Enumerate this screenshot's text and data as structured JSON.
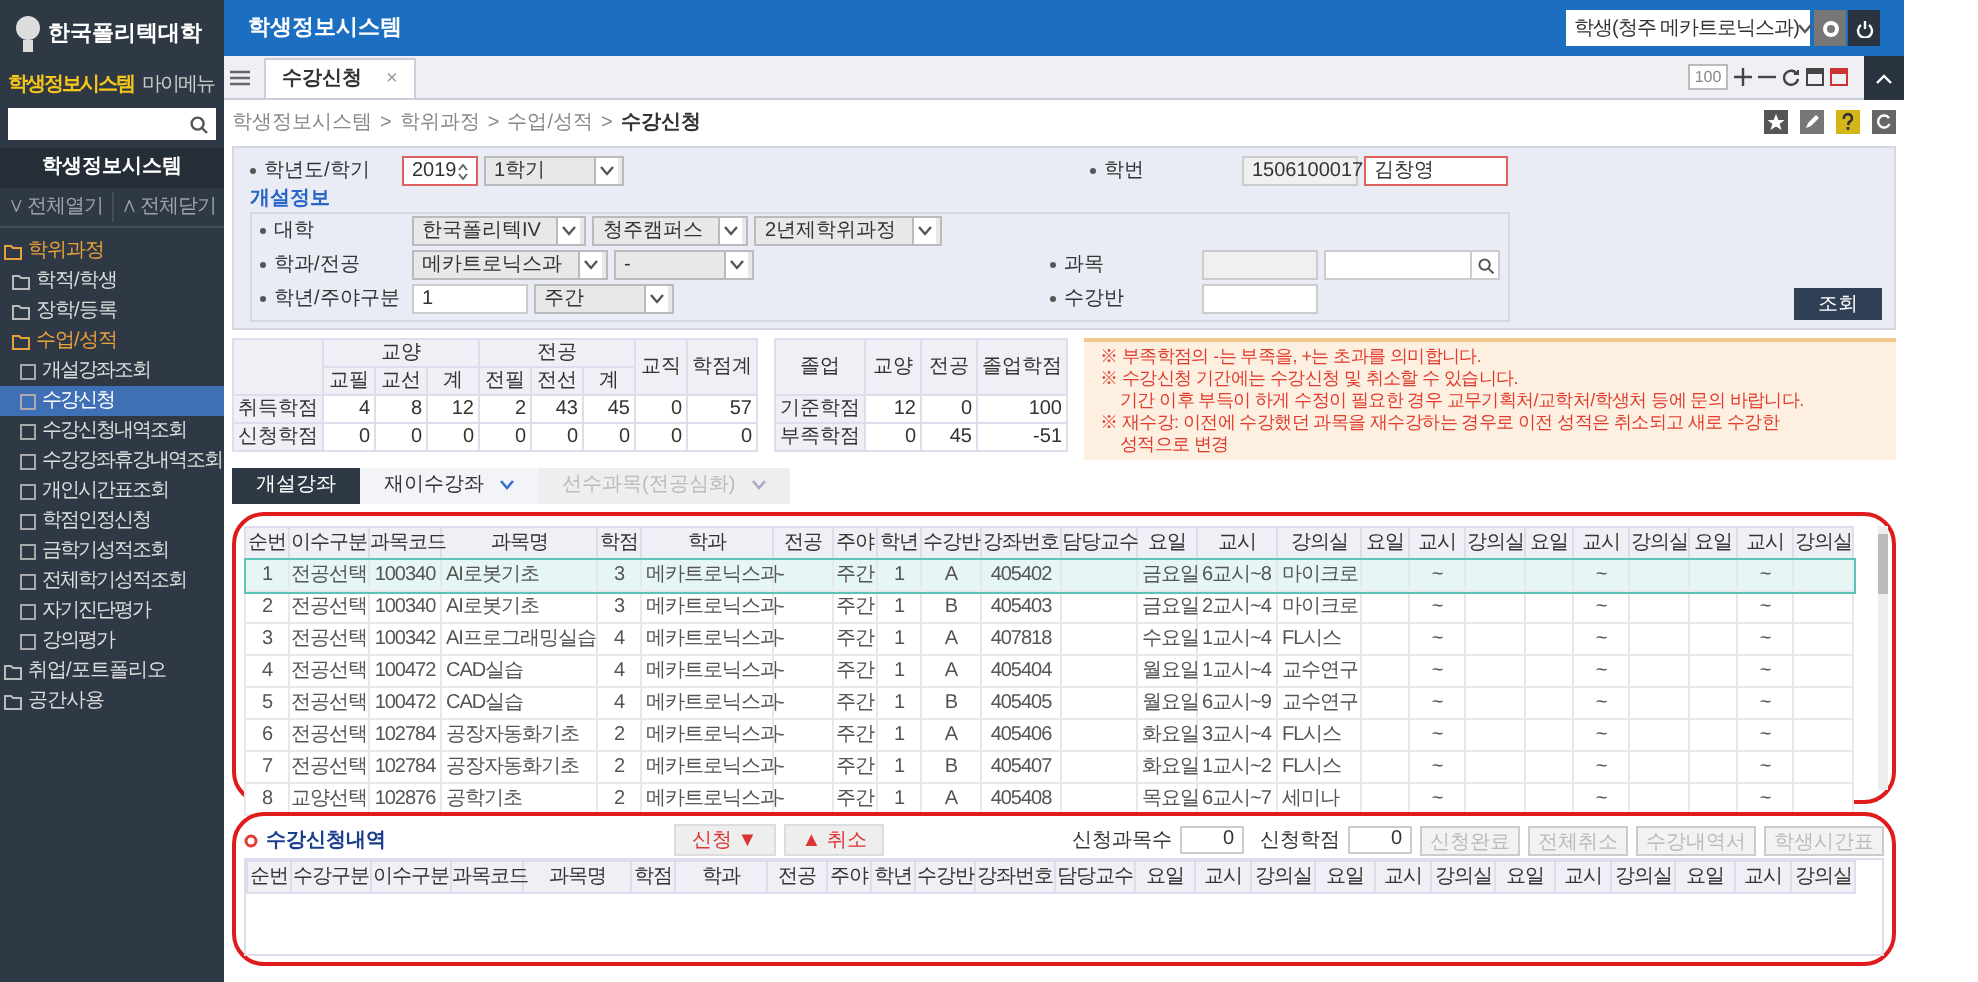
{
  "sidebar": {
    "logo": "한국폴리텍대학",
    "tabs": [
      {
        "label": "학생정보시스템",
        "selected": true
      },
      {
        "label": "마이메뉴",
        "selected": false
      }
    ],
    "section_title": "학생정보시스템",
    "expand_all": "∨ 전체열기",
    "collapse_all": "∧ 전체닫기",
    "tree": [
      {
        "kind": "folder",
        "label": "학위과정",
        "expanded": true,
        "children": [
          {
            "kind": "folder",
            "label": "학적/학생",
            "expanded": false
          },
          {
            "kind": "folder",
            "label": "장학/등록",
            "expanded": false
          },
          {
            "kind": "folder",
            "label": "수업/성적",
            "expanded": true,
            "children": [
              {
                "kind": "page",
                "label": "개설강좌조회",
                "selected": false
              },
              {
                "kind": "page",
                "label": "수강신청",
                "selected": true
              },
              {
                "kind": "page",
                "label": "수강신청내역조회",
                "selected": false
              },
              {
                "kind": "page",
                "label": "수강강좌휴강내역조회",
                "selected": false
              },
              {
                "kind": "page",
                "label": "개인시간표조회",
                "selected": false
              },
              {
                "kind": "page",
                "label": "학점인정신청",
                "selected": false
              },
              {
                "kind": "page",
                "label": "금학기성적조회",
                "selected": false
              },
              {
                "kind": "page",
                "label": "전체학기성적조회",
                "selected": false
              },
              {
                "kind": "page",
                "label": "자기진단평가",
                "selected": false
              },
              {
                "kind": "page",
                "label": "강의평가",
                "selected": false
              }
            ]
          }
        ]
      },
      {
        "kind": "folder",
        "label": "취업/포트폴리오",
        "expanded": false
      },
      {
        "kind": "folder",
        "label": "공간사용",
        "expanded": false
      }
    ]
  },
  "top_bar": {
    "title": "학생정보시스템",
    "user_select": "학생(청주 메카트로닉스과)"
  },
  "tab_bar": {
    "tabs": [
      {
        "label": "수강신청",
        "selected": true,
        "close": "×"
      }
    ],
    "zoom": "100"
  },
  "breadcrumb": {
    "separator": ">",
    "items": [
      "학생정보시스템",
      "학위과정",
      "수업/성적",
      "수강신청"
    ]
  },
  "form": {
    "top_left": {
      "label": "학년도/학기",
      "controls": [
        {
          "kind": "spinner",
          "value": "2019"
        },
        {
          "kind": "select",
          "value": "1학기"
        }
      ]
    },
    "top_right": {
      "label": "학번",
      "controls": [
        {
          "kind": "text",
          "value": "1506100017",
          "readonly": true
        },
        {
          "kind": "text",
          "value": "김창영",
          "highlighted": true
        }
      ]
    },
    "group": {
      "title": "개설정보",
      "left": [
        {
          "label": "대학",
          "controls": [
            {
              "kind": "select",
              "value": "한국폴리텍IV"
            },
            {
              "kind": "select",
              "value": "청주캠퍼스"
            },
            {
              "kind": "select",
              "value": "2년제학위과정"
            }
          ]
        },
        {
          "label": "학과/전공",
          "controls": [
            {
              "kind": "select",
              "value": "메카트로닉스과"
            },
            {
              "kind": "select",
              "value": "-"
            }
          ]
        },
        {
          "label": "학년/주야구분",
          "controls": [
            {
              "kind": "text",
              "value": "1"
            },
            {
              "kind": "select",
              "value": "주간"
            }
          ]
        }
      ],
      "right": [
        {
          "label": "과목",
          "controls": [
            {
              "kind": "text",
              "readonly": true
            },
            {
              "kind": "search"
            }
          ]
        },
        {
          "label": "수강반",
          "controls": [
            {
              "kind": "text"
            }
          ]
        }
      ]
    },
    "search_button": "조회"
  },
  "credit_table": {
    "groups": [
      {
        "label": "교양",
        "columns": [
          "교필",
          "교선",
          "계"
        ]
      },
      {
        "label": "전공",
        "columns": [
          "전필",
          "전선",
          "계"
        ]
      },
      {
        "label": "교직"
      },
      {
        "label": "학점계"
      }
    ],
    "rows": [
      {
        "label": "취득학점",
        "values": [
          "4",
          "8",
          "12",
          "2",
          "43",
          "45",
          "0",
          "57"
        ]
      },
      {
        "label": "신청학점",
        "values": [
          "0",
          "0",
          "0",
          "0",
          "0",
          "0",
          "0",
          "0"
        ]
      }
    ]
  },
  "graduation_table": {
    "columns": [
      "졸업",
      "교양",
      "전공",
      "졸업학점"
    ],
    "rows": [
      {
        "label": "기준학점",
        "values": [
          "12",
          "0",
          "100"
        ]
      },
      {
        "label": "부족학점",
        "values": [
          "0",
          "45",
          "-51"
        ]
      }
    ]
  },
  "notice": [
    "※ 부족학점의 -는 부족을, +는 초과를 의미합니다.",
    "※ 수강신청 기간에는 수강신청 및 취소할 수 있습니다.",
    "기간 이후 부득이 하게 수정이 필요한 경우 교무기획처/교학처/학생처 등에 문의 바랍니다.",
    "※ 재수강: 이전에 수강했던 과목을 재수강하는 경우로 이전 성적은 취소되고 새로 수강한",
    "성적으로 변경"
  ],
  "sub_tabs": [
    {
      "label": "개설강좌",
      "selected": true,
      "disabled": false,
      "dropdown": false
    },
    {
      "label": "재이수강좌",
      "selected": false,
      "disabled": false,
      "dropdown": true
    },
    {
      "label": "선수과목(전공심화)",
      "selected": false,
      "disabled": true,
      "dropdown": true
    }
  ],
  "course_table": {
    "columns": [
      "순번",
      "이수구분",
      "과목코드",
      "과목명",
      "학점",
      "학과",
      "전공",
      "주야",
      "학년",
      "수강반",
      "강좌번호",
      "담당교수",
      "요일",
      "교시",
      "강의실",
      "요일",
      "교시",
      "강의실",
      "요일",
      "교시",
      "강의실",
      "요일",
      "교시",
      "강의실"
    ],
    "rows": [
      {
        "selected": true,
        "cells": [
          "1",
          "전공선택",
          "100340",
          "AI로봇기초",
          "3",
          "메카트로닉스과",
          "-",
          "주간",
          "1",
          "A",
          "405402",
          "",
          "금요일",
          "6교시~8",
          "마이크로",
          "",
          "~",
          "",
          "",
          "~",
          "",
          "",
          "~",
          ""
        ]
      },
      {
        "selected": false,
        "cells": [
          "2",
          "전공선택",
          "100340",
          "AI로봇기초",
          "3",
          "메카트로닉스과",
          "-",
          "주간",
          "1",
          "B",
          "405403",
          "",
          "금요일",
          "2교시~4",
          "마이크로",
          "",
          "~",
          "",
          "",
          "~",
          "",
          "",
          "~",
          ""
        ]
      },
      {
        "selected": false,
        "cells": [
          "3",
          "전공선택",
          "100342",
          "AI프로그래밍실습",
          "4",
          "메카트로닉스과",
          "-",
          "주간",
          "1",
          "A",
          "407818",
          "",
          "수요일",
          "1교시~4",
          "FL시스",
          "",
          "~",
          "",
          "",
          "~",
          "",
          "",
          "~",
          ""
        ]
      },
      {
        "selected": false,
        "cells": [
          "4",
          "전공선택",
          "100472",
          "CAD실습",
          "4",
          "메카트로닉스과",
          "-",
          "주간",
          "1",
          "A",
          "405404",
          "",
          "월요일",
          "1교시~4",
          "교수연구",
          "",
          "~",
          "",
          "",
          "~",
          "",
          "",
          "~",
          ""
        ]
      },
      {
        "selected": false,
        "cells": [
          "5",
          "전공선택",
          "100472",
          "CAD실습",
          "4",
          "메카트로닉스과",
          "-",
          "주간",
          "1",
          "B",
          "405405",
          "",
          "월요일",
          "6교시~9",
          "교수연구",
          "",
          "~",
          "",
          "",
          "~",
          "",
          "",
          "~",
          ""
        ]
      },
      {
        "selected": false,
        "cells": [
          "6",
          "전공선택",
          "102784",
          "공장자동화기초",
          "2",
          "메카트로닉스과",
          "-",
          "주간",
          "1",
          "A",
          "405406",
          "",
          "화요일",
          "3교시~4",
          "FL시스",
          "",
          "~",
          "",
          "",
          "~",
          "",
          "",
          "~",
          ""
        ]
      },
      {
        "selected": false,
        "cells": [
          "7",
          "전공선택",
          "102784",
          "공장자동화기초",
          "2",
          "메카트로닉스과",
          "-",
          "주간",
          "1",
          "B",
          "405407",
          "",
          "화요일",
          "1교시~2",
          "FL시스",
          "",
          "~",
          "",
          "",
          "~",
          "",
          "",
          "~",
          ""
        ]
      },
      {
        "selected": false,
        "cells": [
          "8",
          "교양선택",
          "102876",
          "공학기초",
          "2",
          "메카트로닉스과",
          "-",
          "주간",
          "1",
          "A",
          "405408",
          "",
          "목요일",
          "6교시~7",
          "세미나",
          "",
          "~",
          "",
          "",
          "~",
          "",
          "",
          "~",
          ""
        ]
      }
    ]
  },
  "enrollment": {
    "title": "수강신청내역",
    "move_buttons": [
      "신청 ▼",
      "▲ 취소"
    ],
    "summary": [
      {
        "label": "신청과목수",
        "value": "0"
      },
      {
        "label": "신청학점",
        "value": "0"
      }
    ],
    "actions": [
      {
        "label": "신청완료",
        "disabled": true
      },
      {
        "label": "전체취소",
        "disabled": true
      },
      {
        "label": "수강내역서",
        "disabled": true
      },
      {
        "label": "학생시간표",
        "disabled": true
      }
    ],
    "columns": [
      "순번",
      "수강구분",
      "이수구분",
      "과목코드",
      "과목명",
      "학점",
      "학과",
      "전공",
      "주야",
      "학년",
      "수강반",
      "강좌번호",
      "담당교수",
      "요일",
      "교시",
      "강의실",
      "요일",
      "교시",
      "강의실",
      "요일",
      "교시",
      "강의실",
      "요일",
      "교시",
      "강의실"
    ]
  }
}
